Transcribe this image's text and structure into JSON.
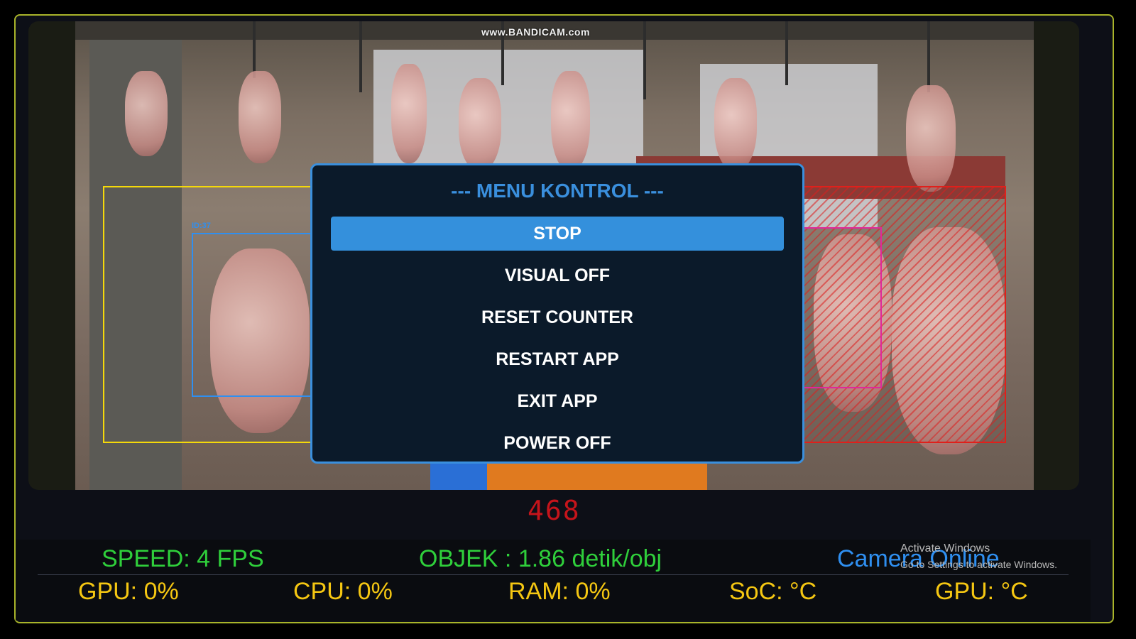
{
  "watermark": "www.BANDICAM.com",
  "detections": {
    "blue_label": "ID:37"
  },
  "menu": {
    "title": "--- MENU KONTROL ---",
    "items": [
      {
        "label": "STOP",
        "selected": true
      },
      {
        "label": "VISUAL OFF",
        "selected": false
      },
      {
        "label": "RESET COUNTER",
        "selected": false
      },
      {
        "label": "RESTART APP",
        "selected": false
      },
      {
        "label": "EXIT APP",
        "selected": false
      },
      {
        "label": "POWER OFF",
        "selected": false
      }
    ]
  },
  "counter": "468",
  "status": {
    "speed": "SPEED: 4 FPS",
    "objek": "OBJEK : 1.86 detik/obj",
    "camera": "Camera Online",
    "gpu_usage": "GPU: 0%",
    "cpu_usage": "CPU: 0%",
    "ram_usage": "RAM: 0%",
    "soc_temp": "SoC: °C",
    "gpu_temp": "GPU: °C"
  },
  "os_overlay": {
    "title": "Activate Windows",
    "subtitle": "Go to Settings to activate Windows."
  },
  "colors": {
    "frame_border": "#a9b42a",
    "menu_accent": "#3a8fdd",
    "selected_bg": "#3490dc",
    "green": "#2fcf3b",
    "yellow": "#f5c712",
    "counter_red": "#c5141b"
  }
}
